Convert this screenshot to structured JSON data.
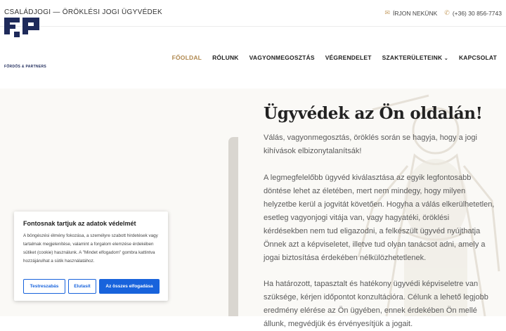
{
  "topbar": {
    "title": "CSALÁDJOGI — ÖRÖKLÉSI JOGI ÜGYVÉDEK",
    "write_us": "ÍRJON NEKÜNK",
    "phone": "(+36) 30 856-7743",
    "mail_icon": "mail-icon",
    "phone_icon": "phone-icon"
  },
  "logo": {
    "text": "FŐRDŐS & PARTNERS"
  },
  "nav": {
    "items": [
      "FŐOLDAL",
      "RÓLUNK",
      "VAGYONMEGOSZTÁS",
      "VÉGRENDELET",
      "SZAKTERÜLETEINK",
      "KAPCSOLAT"
    ],
    "active": "FŐOLDAL",
    "dropdown_icon": "chevron-down-icon"
  },
  "hero": {
    "heading": "Ügyvédek az Ön oldalán!",
    "paragraphs": [
      "Válás, vagyonmegosztás, öröklés során se hagyja, hogy a jogi kihívások elbizonytalanítsák!",
      "A legmegfelelőbb ügyvéd kiválasztása az egyik legfontosabb döntése lehet az életében, mert nem mindegy, hogy milyen helyzetbe kerül a jogvitát követően. Hogyha a válás elkerülhetetlen, esetleg vagyonjogi vitája van, vagy hagyatéki, öröklési kérdésekben nem tud eligazodni, a felkészült ügyvéd nyújthatja Önnek azt a képviseletet, illetve tud olyan tanácsot adni, amely a jogai biztosítása érdekében nélkülözhetetlenek.",
      "Ha határozott, tapasztalt és hatékony ügyvédi képviseletre van szüksége, kérjen időpontot konzultációra. Célunk a lehető legjobb eredmény elérése az Ön ügyében, ennek érdekében Ön mellé állunk, megvédjük és érvényesítjük a jogait."
    ]
  },
  "cookie": {
    "title": "Fontosnak tartjuk az adatok védelmét",
    "text": "A böngészési élmény fokozása, a személyre szabott hirdetések vagy tartalmak megjelenítése, valamint a forgalom elemzése érdekében sütiket (cookie) használunk. A \"Mindet elfogadom\" gombra kattintva hozzájárulhat a sütik használatához.",
    "customize": "Testreszabás",
    "reject": "Elutasít",
    "accept_all": "Az összes elfogadása",
    "accent": "#1863dc"
  },
  "colors": {
    "brand_gold": "#b0884f",
    "logo_navy": "#1e2a5a"
  }
}
